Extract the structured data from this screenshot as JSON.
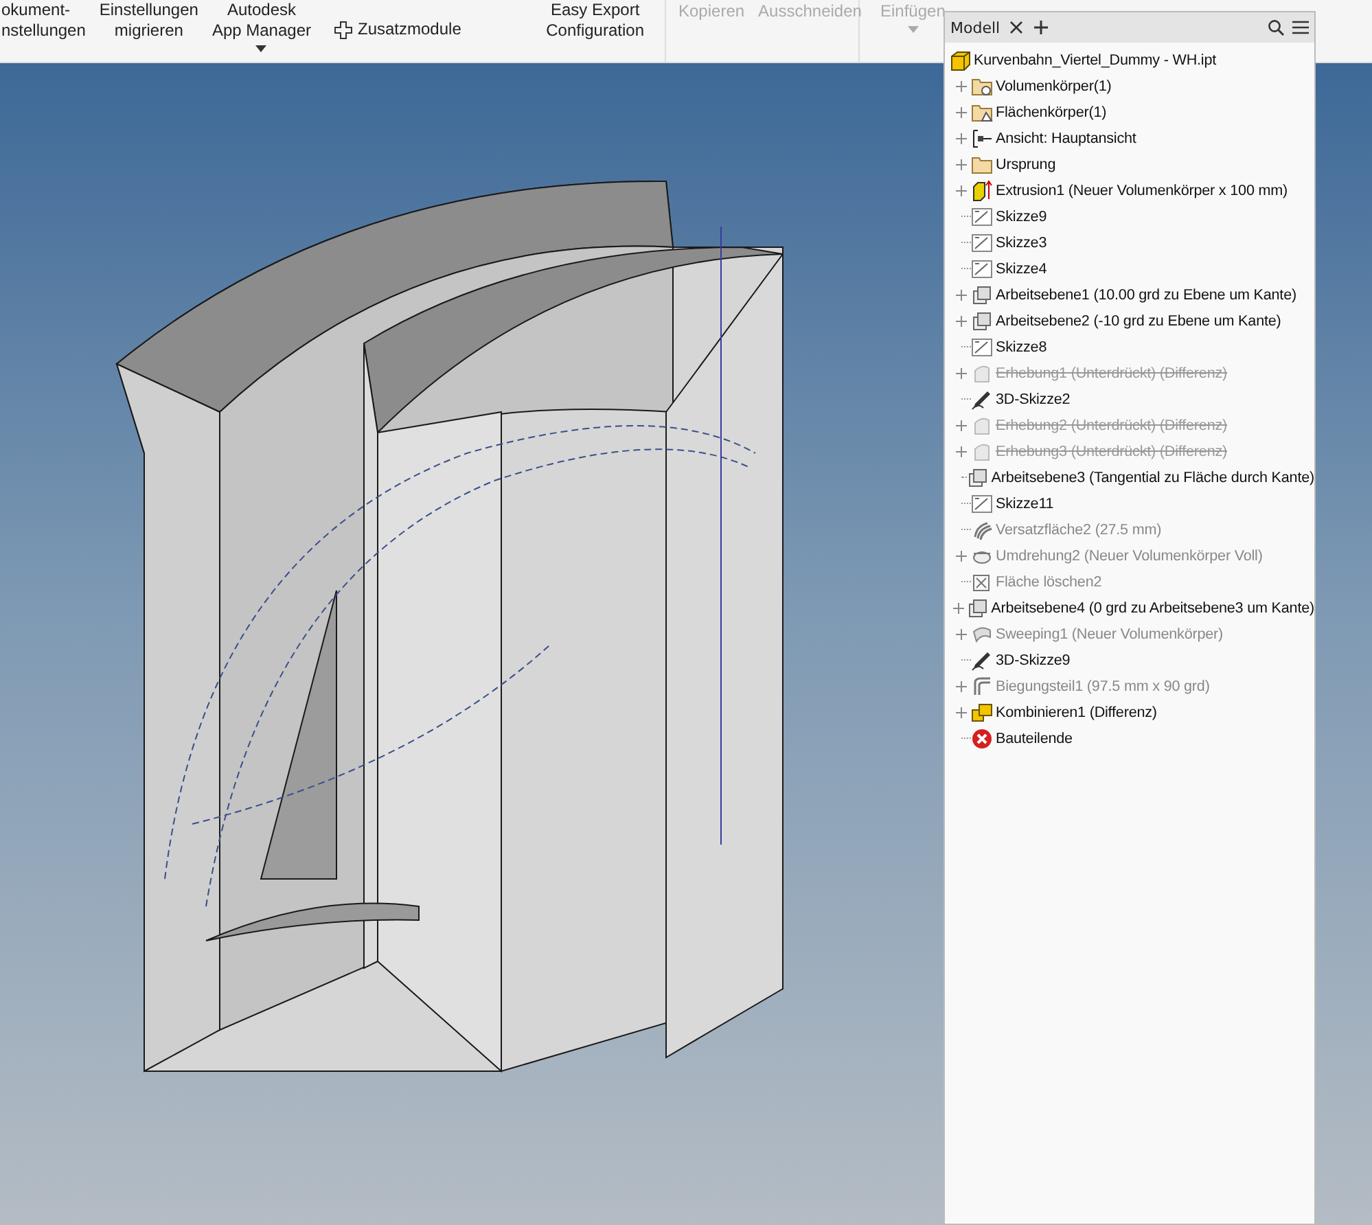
{
  "toolbar": {
    "panels": [
      {
        "buttons": [
          {
            "kind": "large",
            "lines": [
              "okument-",
              "nstellungen"
            ],
            "disabled": false,
            "dropdown": false
          },
          {
            "kind": "large",
            "lines": [
              "Einstellungen",
              "migrieren"
            ],
            "disabled": false,
            "dropdown": false
          },
          {
            "kind": "large",
            "lines": [
              "Autodesk",
              "App Manager"
            ],
            "disabled": false,
            "dropdown": true
          },
          {
            "kind": "small",
            "lines": [
              "Zusatzmodule"
            ],
            "disabled": false,
            "dropdown": false
          },
          {
            "kind": "large",
            "lines": [
              "Easy Export",
              "Configuration"
            ],
            "disabled": false,
            "dropdown": false
          }
        ]
      },
      {
        "buttons": [
          {
            "kind": "text",
            "lines": [
              "Kopieren"
            ],
            "disabled": true,
            "dropdown": false
          },
          {
            "kind": "text",
            "lines": [
              "Ausschneiden"
            ],
            "disabled": true,
            "dropdown": false
          }
        ]
      },
      {
        "buttons": [
          {
            "kind": "text",
            "lines": [
              "Einfügen"
            ],
            "disabled": true,
            "dropdown": true
          }
        ]
      }
    ]
  },
  "browser": {
    "tab": {
      "label": "Modell"
    },
    "root": {
      "label": "Kurvenbahn_Viertel_Dummy - WH.ipt",
      "kind": "part",
      "children": [
        {
          "label": "Volumenkörper(1)",
          "kind": "solid-folder",
          "has_children": true,
          "dimmed": false,
          "suppressed": false
        },
        {
          "label": "Flächenkörper(1)",
          "kind": "surface-folder",
          "has_children": true,
          "dimmed": false,
          "suppressed": false
        },
        {
          "label": "Ansicht: Hauptansicht",
          "kind": "view",
          "has_children": true,
          "dimmed": false,
          "suppressed": false
        },
        {
          "label": "Ursprung",
          "kind": "folder",
          "has_children": true,
          "dimmed": false,
          "suppressed": false
        },
        {
          "label": "Extrusion1 (Neuer Volumenkörper x 100 mm)",
          "kind": "extrusion",
          "has_children": true,
          "dimmed": false,
          "suppressed": false
        },
        {
          "label": "Skizze9",
          "kind": "sketch",
          "has_children": false,
          "dimmed": false,
          "suppressed": false
        },
        {
          "label": "Skizze3",
          "kind": "sketch",
          "has_children": false,
          "dimmed": false,
          "suppressed": false
        },
        {
          "label": "Skizze4",
          "kind": "sketch",
          "has_children": false,
          "dimmed": false,
          "suppressed": false
        },
        {
          "label": "Arbeitsebene1 (10.00 grd zu Ebene um Kante)",
          "kind": "plane",
          "has_children": true,
          "dimmed": false,
          "suppressed": false
        },
        {
          "label": "Arbeitsebene2 (-10 grd zu Ebene um Kante)",
          "kind": "plane",
          "has_children": true,
          "dimmed": false,
          "suppressed": false
        },
        {
          "label": "Skizze8",
          "kind": "sketch",
          "has_children": false,
          "dimmed": false,
          "suppressed": false
        },
        {
          "label": "Erhebung1 (Unterdrückt) (Differenz)",
          "kind": "loft",
          "has_children": true,
          "dimmed": false,
          "suppressed": true
        },
        {
          "label": "3D-Skizze2",
          "kind": "sketch3d",
          "has_children": false,
          "dimmed": false,
          "suppressed": false
        },
        {
          "label": "Erhebung2 (Unterdrückt) (Differenz)",
          "kind": "loft",
          "has_children": true,
          "dimmed": false,
          "suppressed": true
        },
        {
          "label": "Erhebung3 (Unterdrückt) (Differenz)",
          "kind": "loft",
          "has_children": true,
          "dimmed": false,
          "suppressed": true
        },
        {
          "label": "Arbeitsebene3 (Tangential zu Fläche durch Kante)",
          "kind": "plane",
          "has_children": false,
          "dimmed": false,
          "suppressed": false
        },
        {
          "label": "Skizze11",
          "kind": "sketch",
          "has_children": false,
          "dimmed": false,
          "suppressed": false
        },
        {
          "label": "Versatzfläche2 (27.5 mm)",
          "kind": "offset",
          "has_children": false,
          "dimmed": true,
          "suppressed": false
        },
        {
          "label": "Umdrehung2 (Neuer Volumenkörper Voll)",
          "kind": "revolve",
          "has_children": true,
          "dimmed": true,
          "suppressed": false
        },
        {
          "label": "Fläche löschen2",
          "kind": "delete-face",
          "has_children": false,
          "dimmed": true,
          "suppressed": false
        },
        {
          "label": "Arbeitsebene4 (0 grd zu Arbeitsebene3 um Kante)",
          "kind": "plane",
          "has_children": true,
          "dimmed": false,
          "suppressed": false
        },
        {
          "label": "Sweeping1 (Neuer Volumenkörper)",
          "kind": "sweep",
          "has_children": true,
          "dimmed": true,
          "suppressed": false
        },
        {
          "label": "3D-Skizze9",
          "kind": "sketch3d",
          "has_children": false,
          "dimmed": false,
          "suppressed": false
        },
        {
          "label": "Biegungsteil1 (97.5 mm x 90 grd)",
          "kind": "bend",
          "has_children": true,
          "dimmed": true,
          "suppressed": false
        },
        {
          "label": "Kombinieren1 (Differenz)",
          "kind": "combine",
          "has_children": true,
          "dimmed": false,
          "suppressed": false
        },
        {
          "label": "Bauteilende",
          "kind": "end",
          "has_children": false,
          "dimmed": false,
          "suppressed": false
        }
      ]
    }
  }
}
